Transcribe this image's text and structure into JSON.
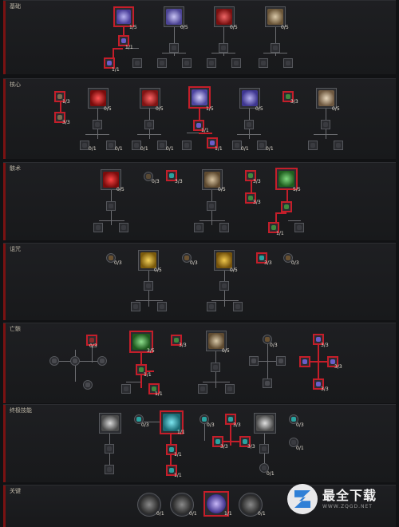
{
  "sections": [
    {
      "title": "基础"
    },
    {
      "title": "核心"
    },
    {
      "title": "骸术"
    },
    {
      "title": "诅咒"
    },
    {
      "title": "亡骸"
    },
    {
      "title": "终极技能"
    },
    {
      "title": "关键"
    }
  ],
  "counts": {
    "b1": "1/5",
    "b2": "0/5",
    "b3": "0/5",
    "b4": "0/5",
    "b1a": "1/1",
    "b1b": "1/1",
    "c_l1": "1/3",
    "c_l2": "3/3",
    "c1": "0/5",
    "c2": "0/5",
    "c3": "1/5",
    "c4": "0/5",
    "c5": "3/3",
    "c6": "0/5",
    "c3a": "1/1",
    "c3b": "1/1",
    "c_r1": "0/1",
    "c_r2": "0/1",
    "c_r3": "0/1",
    "c_r4": "0/1",
    "c_r5": "0/1",
    "c_r6": "0/1",
    "o1": "0/5",
    "o2": "0/3",
    "o3": "3/3",
    "o4": "0/5",
    "o5": "3/3",
    "o6": "3/3",
    "o7": "5/5",
    "o7a": "1/1",
    "cu1": "0/3",
    "cu2": "0/5",
    "cu3": "0/3",
    "cu4": "0/5",
    "cu5": "3/3",
    "cu6": "0/3",
    "m1": "0/3",
    "m2": "3/5",
    "m3": "3/3",
    "m4": "0/5",
    "m5": "0/3",
    "m6": "3/3",
    "m7": "3/3",
    "m8": "3/3",
    "m2a": "1/1",
    "m2b": "1/1",
    "u1": "0/3",
    "u2": "1/1",
    "u3": "0/3",
    "u4": "3/3",
    "u5": "3/3",
    "u6": "3/3",
    "u7": "0/1",
    "u8": "0/1",
    "u2a": "1/1",
    "u2b": "1/1",
    "u9": "0/3",
    "k1": "0/1",
    "k2": "0/1",
    "k3": "1/1",
    "k4": "0/1"
  },
  "watermark": {
    "name": "最全下载",
    "url": "WWW.ZQGD.NET"
  },
  "colors": {
    "active_border": "#c41e2a",
    "inactive_border": "#55575c"
  }
}
